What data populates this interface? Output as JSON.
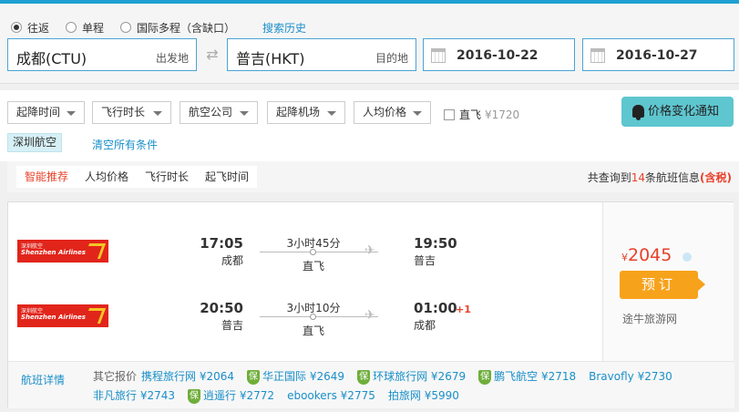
{
  "search": {
    "trip_types": [
      {
        "label": "往返",
        "checked": true
      },
      {
        "label": "单程",
        "checked": false
      },
      {
        "label": "国际多程（含缺口）",
        "checked": false
      }
    ],
    "history_link": "搜索历史",
    "from_city": "成都(CTU)",
    "from_hint": "出发地",
    "swap_icon": "swap-arrows-icon",
    "to_city": "普吉(HKT)",
    "to_hint": "目的地",
    "depart_date": "2016-10-22",
    "return_date": "2016-10-27"
  },
  "filters": {
    "dropdowns": [
      "起降时间",
      "飞行时长",
      "航空公司",
      "起降机场",
      "人均价格"
    ],
    "direct_label": "直飞",
    "direct_price": "¥1720",
    "direct_checked": false,
    "notify_label": "价格变化通知",
    "active_tag": "深圳航空",
    "clear_label": "清空所有条件"
  },
  "sort": {
    "tabs": [
      {
        "label": "智能推荐",
        "active": true
      },
      {
        "label": "人均价格",
        "active": false
      },
      {
        "label": "飞行时长",
        "active": false
      },
      {
        "label": "起飞时间",
        "active": false
      }
    ],
    "summary_prefix": "共查询到",
    "summary_count": "14",
    "summary_suffix": "条航班信息",
    "summary_tax": "(含税)"
  },
  "result": {
    "airline_cn": "深圳航空",
    "airline_en": "Shenzhen Airlines",
    "outbound": {
      "dep_time": "17:05",
      "dep_city": "成都",
      "duration": "3小时45分",
      "stop_type": "直飞",
      "arr_time": "19:50",
      "arr_city": "普吉",
      "plus_day": ""
    },
    "inbound": {
      "dep_time": "20:50",
      "dep_city": "普吉",
      "duration": "3小时10分",
      "stop_type": "直飞",
      "arr_time": "01:00",
      "arr_city": "成都",
      "plus_day": "+1"
    },
    "price_symbol": "¥",
    "price": "2045",
    "book_label": "预订",
    "agency": "途牛旅游网",
    "detail_link": "航班详情",
    "other_label": "其它报价",
    "quotes": [
      {
        "name": "携程旅行网",
        "price": "¥2064",
        "insured": false
      },
      {
        "name": "华正国际",
        "price": "¥2649",
        "insured": true
      },
      {
        "name": "环球旅行网",
        "price": "¥2679",
        "insured": true
      },
      {
        "name": "鹏飞航空",
        "price": "¥2718",
        "insured": true
      },
      {
        "name": "Bravofly",
        "price": "¥2730",
        "insured": false
      },
      {
        "name": "非凡旅行",
        "price": "¥2743",
        "insured": false
      },
      {
        "name": "逍遥行",
        "price": "¥2772",
        "insured": true
      },
      {
        "name": "ebookers",
        "price": "¥2775",
        "insured": false
      },
      {
        "name": "拍旅网",
        "price": "¥5990",
        "insured": false
      }
    ],
    "insured_badge": "保"
  },
  "colors": {
    "accent": "#1fa0d4",
    "price": "#e8412a",
    "book": "#f7a21b",
    "notify": "#5ec6cf"
  }
}
